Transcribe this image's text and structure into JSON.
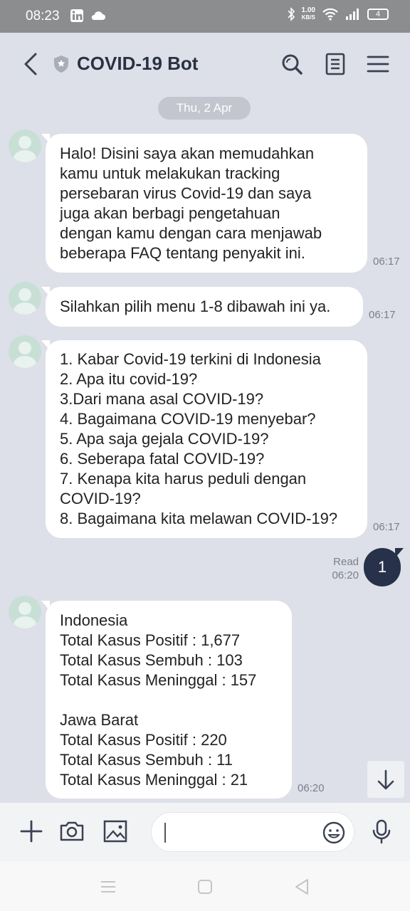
{
  "status_bar": {
    "time": "08:23",
    "net_speed_value": "1.00",
    "net_speed_unit": "KB/S",
    "battery": "4"
  },
  "header": {
    "title": "COVID-19 Bot",
    "icons": [
      "back-icon",
      "shield-icon",
      "search-icon",
      "notes-icon",
      "menu-icon"
    ]
  },
  "chat": {
    "date_label": "Thu, 2 Apr",
    "messages": [
      {
        "text": "Halo! Disini saya akan memudahkan\nkamu untuk melakukan tracking\npersebaran virus Covid-19 dan saya\njuga akan berbagi pengetahuan\ndengan kamu dengan cara menjawab\nbeberapa FAQ tentang penyakit ini.",
        "time": "06:17"
      },
      {
        "text": "Silahkan pilih menu 1-8 dibawah ini ya.",
        "time": "06:17"
      },
      {
        "text": "1. Kabar Covid-19 terkini di Indonesia\n2. Apa itu covid-19?\n3.Dari mana asal COVID-19?\n4. Bagaimana COVID-19 menyebar?\n5. Apa saja gejala COVID-19?\n6. Seberapa fatal COVID-19?\n7. Kenapa kita harus peduli dengan\nCOVID-19?\n8. Bagaimana kita melawan COVID-19?",
        "time": "06:17"
      },
      {
        "text": "Indonesia\nTotal Kasus Positif : 1,677\nTotal Kasus Sembuh : 103\nTotal Kasus Meninggal : 157\n\nJawa Barat\nTotal Kasus Positif : 220\nTotal Kasus Sembuh : 11\nTotal Kasus Meninggal : 21",
        "time": "06:20"
      }
    ],
    "outgoing": {
      "text": "1",
      "read_label": "Read",
      "time": "06:20"
    }
  },
  "input": {
    "placeholder": "",
    "icons": [
      "plus-icon",
      "camera-icon",
      "image-icon",
      "emoji-icon",
      "mic-icon"
    ]
  },
  "colors": {
    "background": "#dde0e8",
    "outgoing_bubble": "#27324a",
    "incoming_bubble": "#ffffff"
  }
}
